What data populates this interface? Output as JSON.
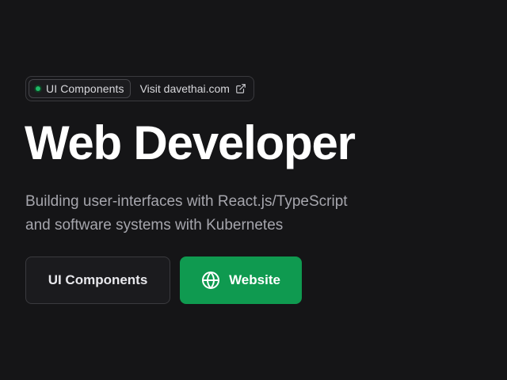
{
  "badge": {
    "tag_label": "UI Components",
    "link_label": "Visit davethai.com",
    "link_icon": "external-link-icon",
    "status_color": "#1fb866"
  },
  "hero": {
    "title": "Web Developer",
    "description_lines": [
      "Building user-interfaces with React.js/TypeScript",
      "and software systems with Kubernetes"
    ]
  },
  "actions": {
    "secondary_label": "UI Components",
    "primary_label": "Website",
    "primary_icon": "globe-icon",
    "primary_color": "#0f9a50"
  }
}
